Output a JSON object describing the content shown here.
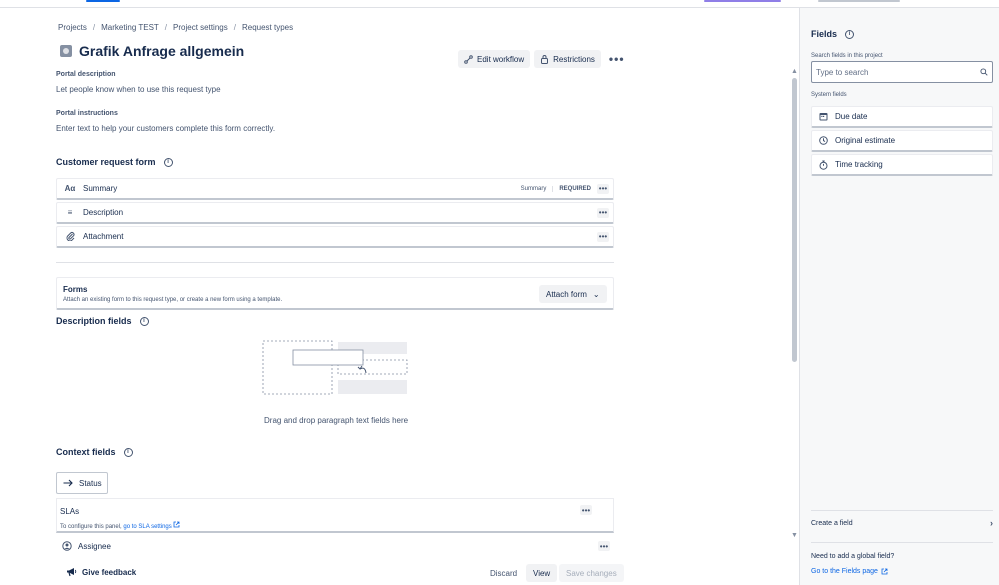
{
  "breadcrumb": {
    "items": [
      "Projects",
      "Marketing TEST",
      "Project settings",
      "Request types"
    ],
    "separator": "/"
  },
  "header": {
    "title": "Grafik Anfrage allgemein",
    "edit_workflow": "Edit workflow",
    "restrictions": "Restrictions",
    "more": "•••"
  },
  "portal": {
    "description_label": "Portal description",
    "description_text": "Let people know when to use this request type",
    "instructions_label": "Portal instructions",
    "instructions_text": "Enter text to help your customers complete this form correctly."
  },
  "customer_form": {
    "title": "Customer request form",
    "fields": [
      {
        "label": "Summary",
        "icon": "text-format-icon",
        "icon_glyph": "Aα",
        "tag": "Summary",
        "required": "REQUIRED"
      },
      {
        "label": "Description",
        "icon": "align-left-icon",
        "icon_glyph": "≡"
      },
      {
        "label": "Attachment",
        "icon": "paperclip-icon",
        "icon_glyph": "⌀"
      }
    ]
  },
  "forms": {
    "title": "Forms",
    "description": "Attach an existing form to this request type, or create a new form using a template.",
    "attach_button": "Attach form",
    "chevron": "⌄"
  },
  "description_fields": {
    "title": "Description fields",
    "drop_hint": "Drag and drop paragraph text fields here"
  },
  "context_fields": {
    "title": "Context fields",
    "status_label": "Status",
    "sla_title": "SLAs",
    "sla_desc_prefix": "To configure this panel,",
    "sla_link": "go to SLA settings",
    "assignee_label": "Assignee"
  },
  "footer": {
    "feedback": "Give feedback",
    "discard": "Discard",
    "view": "View",
    "save": "Save changes"
  },
  "panel": {
    "title": "Fields",
    "search_label": "Search fields in this project",
    "search_placeholder": "Type to search",
    "system_label": "System fields",
    "system_fields": [
      {
        "label": "Due date",
        "icon": "calendar-icon",
        "glyph": "▦"
      },
      {
        "label": "Original estimate",
        "icon": "clock-icon",
        "glyph": "◷"
      },
      {
        "label": "Time tracking",
        "icon": "stopwatch-icon",
        "glyph": "⏱"
      }
    ],
    "create_field": "Create a field",
    "global_question": "Need to add a global field?",
    "global_link": "Go to the Fields page"
  },
  "colors": {
    "accent": "#0c66e4",
    "text": "#172b4d",
    "subtle": "#44546f",
    "panel_bg": "#f7f8f9",
    "button_bg": "#f1f2f4"
  }
}
